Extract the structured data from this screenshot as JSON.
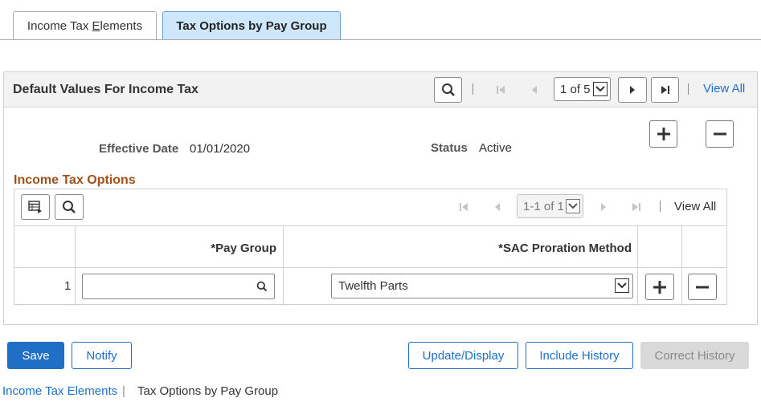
{
  "tabs": [
    {
      "label_pre": "Income Tax ",
      "label_u": "E",
      "label_post": "lements",
      "active": false
    },
    {
      "label": "Tax Options by Pay Group",
      "active": true
    }
  ],
  "panel": {
    "title": "Default Values For Income Tax",
    "pager": {
      "counter": "1 of 5",
      "view_all": "View All"
    },
    "effective_date_label": "Effective Date",
    "effective_date_value": "01/01/2020",
    "status_label": "Status",
    "status_value": "Active"
  },
  "section": {
    "title": "Income Tax Options"
  },
  "grid": {
    "pager": {
      "counter": "1-1 of 1",
      "view_all": "View All"
    },
    "headers": {
      "pay_group": "*Pay Group",
      "sac_method": "*SAC Proration Method"
    },
    "rows": [
      {
        "num": "1",
        "pay_group": "",
        "sac_method": "Twelfth Parts"
      }
    ]
  },
  "buttons": {
    "save": "Save",
    "notify": "Notify",
    "update_display": "Update/Display",
    "include_history": "Include History",
    "correct_history": "Correct History"
  },
  "footer": {
    "link": "Income Tax Elements",
    "separator": "|",
    "current": "Tax Options by Pay Group"
  },
  "icons": {
    "search": "search-icon",
    "first": "first-page-icon",
    "prev": "previous-icon",
    "next": "next-icon",
    "last": "last-page-icon",
    "add": "plus-icon",
    "delete": "minus-icon",
    "personalize": "grid-personalize-icon",
    "dropdown": "chevron-down-icon"
  },
  "colors": {
    "accent": "#1f6fc6",
    "section_title": "#a0521b",
    "active_tab": "#cfe7fb"
  }
}
